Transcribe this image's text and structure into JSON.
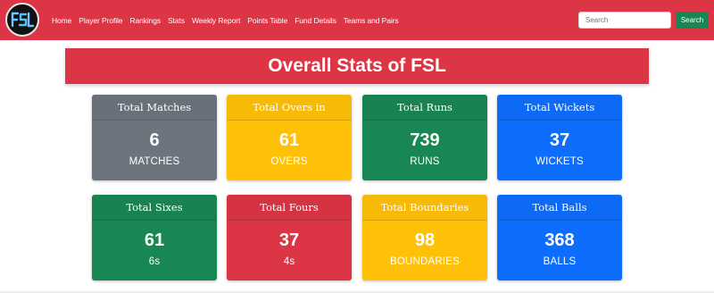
{
  "navbar": {
    "logo_text": "FSL",
    "links": [
      "Home",
      "Player Profile",
      "Rankings",
      "Stats",
      "Weekly Report",
      "Points Table",
      "Fund Details",
      "Teams and Pairs"
    ],
    "search_placeholder": "Search",
    "search_button": "Search",
    "color": "#dc3545"
  },
  "banner": {
    "title": "Overall Stats of FSL"
  },
  "cards": [
    {
      "header": "Total Matches",
      "value": "6",
      "unit": "MATCHES",
      "color": "#6c757d"
    },
    {
      "header": "Total Overs in",
      "value": "61",
      "unit": "OVERS",
      "color": "#ffc107"
    },
    {
      "header": "Total Runs",
      "value": "739",
      "unit": "RUNS",
      "color": "#198754"
    },
    {
      "header": "Total Wickets",
      "value": "37",
      "unit": "WICKETS",
      "color": "#0d6efd"
    },
    {
      "header": "Total Sixes",
      "value": "61",
      "unit": "6s",
      "color": "#198754"
    },
    {
      "header": "Total Fours",
      "value": "37",
      "unit": "4s",
      "color": "#dc3545"
    },
    {
      "header": "Total Boundaries",
      "value": "98",
      "unit": "BOUNDARIES",
      "color": "#ffc107"
    },
    {
      "header": "Total Balls",
      "value": "368",
      "unit": "BALLS",
      "color": "#0d6efd"
    }
  ]
}
